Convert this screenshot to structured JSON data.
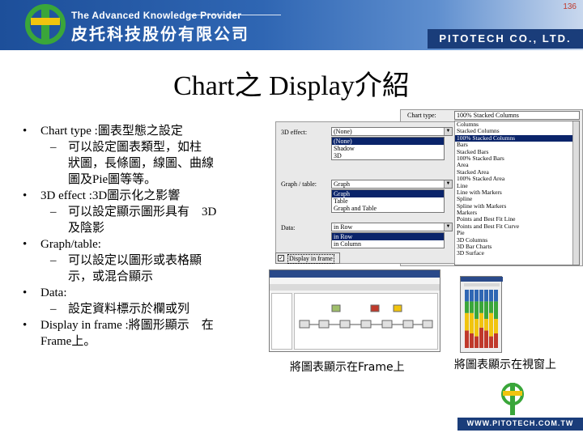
{
  "header": {
    "page_number": "136",
    "brand_en": "The Advanced Knowledge Provider",
    "brand_zh": "皮托科技股份有限公司",
    "company": "PITOTECH CO., LTD."
  },
  "title": "Chart之 Display介紹",
  "bullets": [
    {
      "text": "Chart type :圖表型態之設定",
      "subs": [
        "可以設定圖表類型，如柱",
        "狀圖，長條圖，線圖、曲線",
        "圖及Pie圖等等。"
      ]
    },
    {
      "text": "3D effect :3D圖示化之影響",
      "subs": [
        "可以設定顯示圖形具有　3D",
        "及陰影"
      ]
    },
    {
      "text": "Graph/table:",
      "subs": [
        "可以設定以圖形或表格顯",
        "示，或混合顯示"
      ]
    },
    {
      "text": "Data:",
      "subs": [
        "設定資料標示於欄或列"
      ]
    },
    {
      "text": "Display in frame :將圖形顯示　在",
      "subs": []
    },
    {
      "text": "Frame上。",
      "subs": []
    }
  ],
  "dialog": {
    "effect_label": "3D effect:",
    "effect_value": "(None)",
    "effect_options": [
      "(None)",
      "Shadow",
      "3D"
    ],
    "graph_label": "Graph / table:",
    "graph_value": "Graph",
    "graph_options": [
      "Graph",
      "Table",
      "Graph and Table"
    ],
    "data_label": "Data:",
    "data_value": "in Row",
    "data_options": [
      "in Row",
      "in Column"
    ],
    "display_in_frame": "Display in frame",
    "display_in_frame_checked": true
  },
  "chart_type": {
    "label": "Chart type:",
    "value": "100% Stacked Columns",
    "options": [
      "Columns",
      "Stacked Columns",
      "100% Stacked Columns",
      "Bars",
      "Stacked Bars",
      "100% Stacked Bars",
      "Area",
      "Stacked Area",
      "100% Stacked Area",
      "Line",
      "Line with Markers",
      "Spline",
      "Spline with Markers",
      "Markers",
      "Points and Best Fit Line",
      "Points and Best Fit Curve",
      "Pie",
      "3D Columns",
      "3D Bar Charts",
      "3D Surface"
    ],
    "selected_index": 2
  },
  "captions": {
    "frame": "將圖表顯示在Frame上",
    "window": "將圖表顯示在視窗上"
  },
  "footer": {
    "url": "WWW.PITOTECH.COM.TW"
  },
  "colors": {
    "banner": "#2f66b3",
    "navy": "#1a3d7a",
    "selection": "#0a246a",
    "logo_green": "#3aa63a"
  }
}
